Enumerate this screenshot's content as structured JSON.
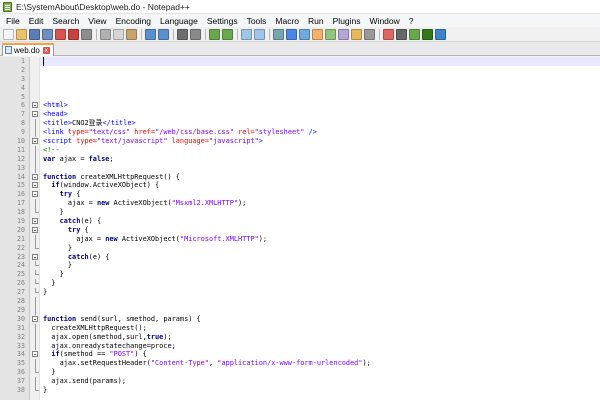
{
  "window": {
    "title": "E:\\SystemAbout\\Desktop\\web.do - Notepad++"
  },
  "menu": [
    "File",
    "Edit",
    "Search",
    "View",
    "Encoding",
    "Language",
    "Settings",
    "Tools",
    "Macro",
    "Run",
    "Plugins",
    "Window",
    "?"
  ],
  "toolbar": {
    "buttons": [
      {
        "icon": "new-file-icon",
        "color": "#f4f4f4"
      },
      {
        "icon": "open-file-icon",
        "color": "#e9c46a"
      },
      {
        "icon": "save-icon",
        "color": "#5b7fb5"
      },
      {
        "icon": "save-all-icon",
        "color": "#6f8fc4"
      },
      {
        "icon": "close-icon",
        "color": "#d9534f"
      },
      {
        "icon": "close-all-icon",
        "color": "#c9423e"
      },
      {
        "icon": "print-icon",
        "color": "#8d8d8d"
      },
      {
        "sep": true
      },
      {
        "icon": "cut-icon",
        "color": "#b0b0b0"
      },
      {
        "icon": "copy-icon",
        "color": "#d6d6d6"
      },
      {
        "icon": "paste-icon",
        "color": "#c8a46a"
      },
      {
        "sep": true
      },
      {
        "icon": "undo-icon",
        "color": "#5a8fd0"
      },
      {
        "icon": "redo-icon",
        "color": "#5a8fd0"
      },
      {
        "sep": true
      },
      {
        "icon": "find-icon",
        "color": "#6e6e6e"
      },
      {
        "icon": "replace-icon",
        "color": "#8a8a8a"
      },
      {
        "sep": true
      },
      {
        "icon": "zoom-in-icon",
        "color": "#6aa84f"
      },
      {
        "icon": "zoom-out-icon",
        "color": "#6aa84f"
      },
      {
        "sep": true
      },
      {
        "icon": "sync-vertical-icon",
        "color": "#9fc5e8"
      },
      {
        "icon": "sync-horizontal-icon",
        "color": "#9fc5e8"
      },
      {
        "sep": true
      },
      {
        "icon": "word-wrap-icon",
        "color": "#76a5af"
      },
      {
        "icon": "show-all-chars-icon",
        "color": "#4a86e8"
      },
      {
        "icon": "indent-guide-icon",
        "color": "#6fa8dc"
      },
      {
        "icon": "language-udl-icon",
        "color": "#f6b26b"
      },
      {
        "icon": "doc-map-icon",
        "color": "#93c47d"
      },
      {
        "icon": "function-list-icon",
        "color": "#b4a7d6"
      },
      {
        "icon": "folder-workspace-icon",
        "color": "#e6b85c"
      },
      {
        "icon": "monitor-icon",
        "color": "#999999"
      },
      {
        "sep": true
      },
      {
        "icon": "macro-record-icon",
        "color": "#e06666"
      },
      {
        "icon": "macro-stop-icon",
        "color": "#666666"
      },
      {
        "icon": "macro-play-icon",
        "color": "#6aa84f"
      },
      {
        "icon": "macro-play-multiple-icon",
        "color": "#38761d"
      },
      {
        "icon": "macro-save-icon",
        "color": "#3d85c6"
      }
    ]
  },
  "tab": {
    "label": "web.do"
  },
  "editor": {
    "lines": [
      {
        "n": "1",
        "fold": "",
        "parts": []
      },
      {
        "n": "2",
        "fold": "",
        "parts": []
      },
      {
        "n": "3",
        "fold": "",
        "parts": []
      },
      {
        "n": "4",
        "fold": "",
        "parts": []
      },
      {
        "n": "5",
        "fold": "",
        "parts": []
      },
      {
        "n": "6",
        "fold": "open",
        "parts": [
          [
            "t-tag",
            "<html>"
          ]
        ]
      },
      {
        "n": "7",
        "fold": "open",
        "parts": [
          [
            "t-tag",
            "<head>"
          ]
        ]
      },
      {
        "n": "8",
        "fold": "line",
        "parts": [
          [
            "t-tag",
            "<title>"
          ],
          [
            "t-plain",
            "CNO2登录"
          ],
          [
            "t-tag",
            "</title>"
          ]
        ]
      },
      {
        "n": "9",
        "fold": "line",
        "parts": [
          [
            "t-tag",
            "<link "
          ],
          [
            "t-attr",
            "type="
          ],
          [
            "t-str",
            "\"text/css\""
          ],
          [
            "t-attr",
            " href="
          ],
          [
            "t-str",
            "\"/web/css/base.css\""
          ],
          [
            "t-attr",
            " rel="
          ],
          [
            "t-str",
            "\"stylesheet\""
          ],
          [
            "t-tag",
            " />"
          ]
        ]
      },
      {
        "n": "10",
        "fold": "open",
        "parts": [
          [
            "t-tag",
            "<script "
          ],
          [
            "t-attr",
            "type="
          ],
          [
            "t-str",
            "\"text/javascript\""
          ],
          [
            "t-attr",
            " language="
          ],
          [
            "t-str",
            "\"javascript\""
          ],
          [
            "t-tag",
            ">"
          ]
        ]
      },
      {
        "n": "11",
        "fold": "line",
        "parts": [
          [
            "t-cmt",
            "<!--"
          ]
        ]
      },
      {
        "n": "12",
        "fold": "line",
        "parts": [
          [
            "t-kw",
            "var"
          ],
          [
            "t-plain",
            " ajax = "
          ],
          [
            "t-kw",
            "false"
          ],
          [
            "t-plain",
            ";"
          ]
        ]
      },
      {
        "n": "13",
        "fold": "line",
        "parts": []
      },
      {
        "n": "14",
        "fold": "open",
        "parts": [
          [
            "t-kw",
            "function"
          ],
          [
            "t-plain",
            " createXMLHttpRequest() {"
          ]
        ]
      },
      {
        "n": "15",
        "fold": "open",
        "parts": [
          [
            "t-plain",
            "  "
          ],
          [
            "t-kw",
            "if"
          ],
          [
            "t-plain",
            "(window.ActiveXObject) {"
          ]
        ]
      },
      {
        "n": "16",
        "fold": "open",
        "parts": [
          [
            "t-plain",
            "    "
          ],
          [
            "t-kw",
            "try"
          ],
          [
            "t-plain",
            " {"
          ]
        ]
      },
      {
        "n": "17",
        "fold": "line",
        "parts": [
          [
            "t-plain",
            "      ajax = "
          ],
          [
            "t-kw",
            "new"
          ],
          [
            "t-plain",
            " ActiveXObject("
          ],
          [
            "t-str",
            "\"Msxml2.XMLHTTP\""
          ],
          [
            "t-plain",
            ");"
          ]
        ]
      },
      {
        "n": "18",
        "fold": "end",
        "parts": [
          [
            "t-plain",
            "    }"
          ]
        ]
      },
      {
        "n": "19",
        "fold": "open",
        "parts": [
          [
            "t-plain",
            "    "
          ],
          [
            "t-kw",
            "catch"
          ],
          [
            "t-plain",
            "(e) {"
          ]
        ]
      },
      {
        "n": "20",
        "fold": "open",
        "parts": [
          [
            "t-plain",
            "      "
          ],
          [
            "t-kw",
            "try"
          ],
          [
            "t-plain",
            " {"
          ]
        ]
      },
      {
        "n": "21",
        "fold": "line",
        "parts": [
          [
            "t-plain",
            "        ajax = "
          ],
          [
            "t-kw",
            "new"
          ],
          [
            "t-plain",
            " ActiveXObject("
          ],
          [
            "t-str",
            "\"Microsoft.XMLHTTP\""
          ],
          [
            "t-plain",
            ");"
          ]
        ]
      },
      {
        "n": "22",
        "fold": "end",
        "parts": [
          [
            "t-plain",
            "      }"
          ]
        ]
      },
      {
        "n": "23",
        "fold": "open",
        "parts": [
          [
            "t-plain",
            "      "
          ],
          [
            "t-kw",
            "catch"
          ],
          [
            "t-plain",
            "(e) {"
          ]
        ]
      },
      {
        "n": "24",
        "fold": "end",
        "parts": [
          [
            "t-plain",
            "      }"
          ]
        ]
      },
      {
        "n": "25",
        "fold": "end",
        "parts": [
          [
            "t-plain",
            "    }"
          ]
        ]
      },
      {
        "n": "26",
        "fold": "end",
        "parts": [
          [
            "t-plain",
            "  }"
          ]
        ]
      },
      {
        "n": "27",
        "fold": "end",
        "parts": [
          [
            "t-plain",
            "}"
          ]
        ]
      },
      {
        "n": "28",
        "fold": "line",
        "parts": []
      },
      {
        "n": "29",
        "fold": "line",
        "parts": []
      },
      {
        "n": "30",
        "fold": "open",
        "parts": [
          [
            "t-kw",
            "function"
          ],
          [
            "t-plain",
            " send(surl, smethod, params) {"
          ]
        ]
      },
      {
        "n": "31",
        "fold": "line",
        "parts": [
          [
            "t-plain",
            "  createXMLHttpRequest();"
          ]
        ]
      },
      {
        "n": "32",
        "fold": "line",
        "parts": [
          [
            "t-plain",
            "  ajax.open(smethod,surl,"
          ],
          [
            "t-kw",
            "true"
          ],
          [
            "t-plain",
            ");"
          ]
        ]
      },
      {
        "n": "33",
        "fold": "line",
        "parts": [
          [
            "t-plain",
            "  ajax.onreadystatechange=proce;"
          ]
        ]
      },
      {
        "n": "34",
        "fold": "open",
        "parts": [
          [
            "t-plain",
            "  "
          ],
          [
            "t-kw",
            "if"
          ],
          [
            "t-plain",
            "(smethod == "
          ],
          [
            "t-str",
            "\"POST\""
          ],
          [
            "t-plain",
            ") {"
          ]
        ]
      },
      {
        "n": "35",
        "fold": "line",
        "parts": [
          [
            "t-plain",
            "    ajax.setRequestHeader("
          ],
          [
            "t-str",
            "\"Content-Type\""
          ],
          [
            "t-plain",
            ", "
          ],
          [
            "t-str",
            "\"application/x-www-form-urlencoded\""
          ],
          [
            "t-plain",
            ");"
          ]
        ]
      },
      {
        "n": "36",
        "fold": "end",
        "parts": [
          [
            "t-plain",
            "  }"
          ]
        ]
      },
      {
        "n": "37",
        "fold": "line",
        "parts": [
          [
            "t-plain",
            "  ajax.send(params);"
          ]
        ]
      },
      {
        "n": "38",
        "fold": "end",
        "parts": [
          [
            "t-plain",
            "}"
          ]
        ]
      }
    ]
  }
}
